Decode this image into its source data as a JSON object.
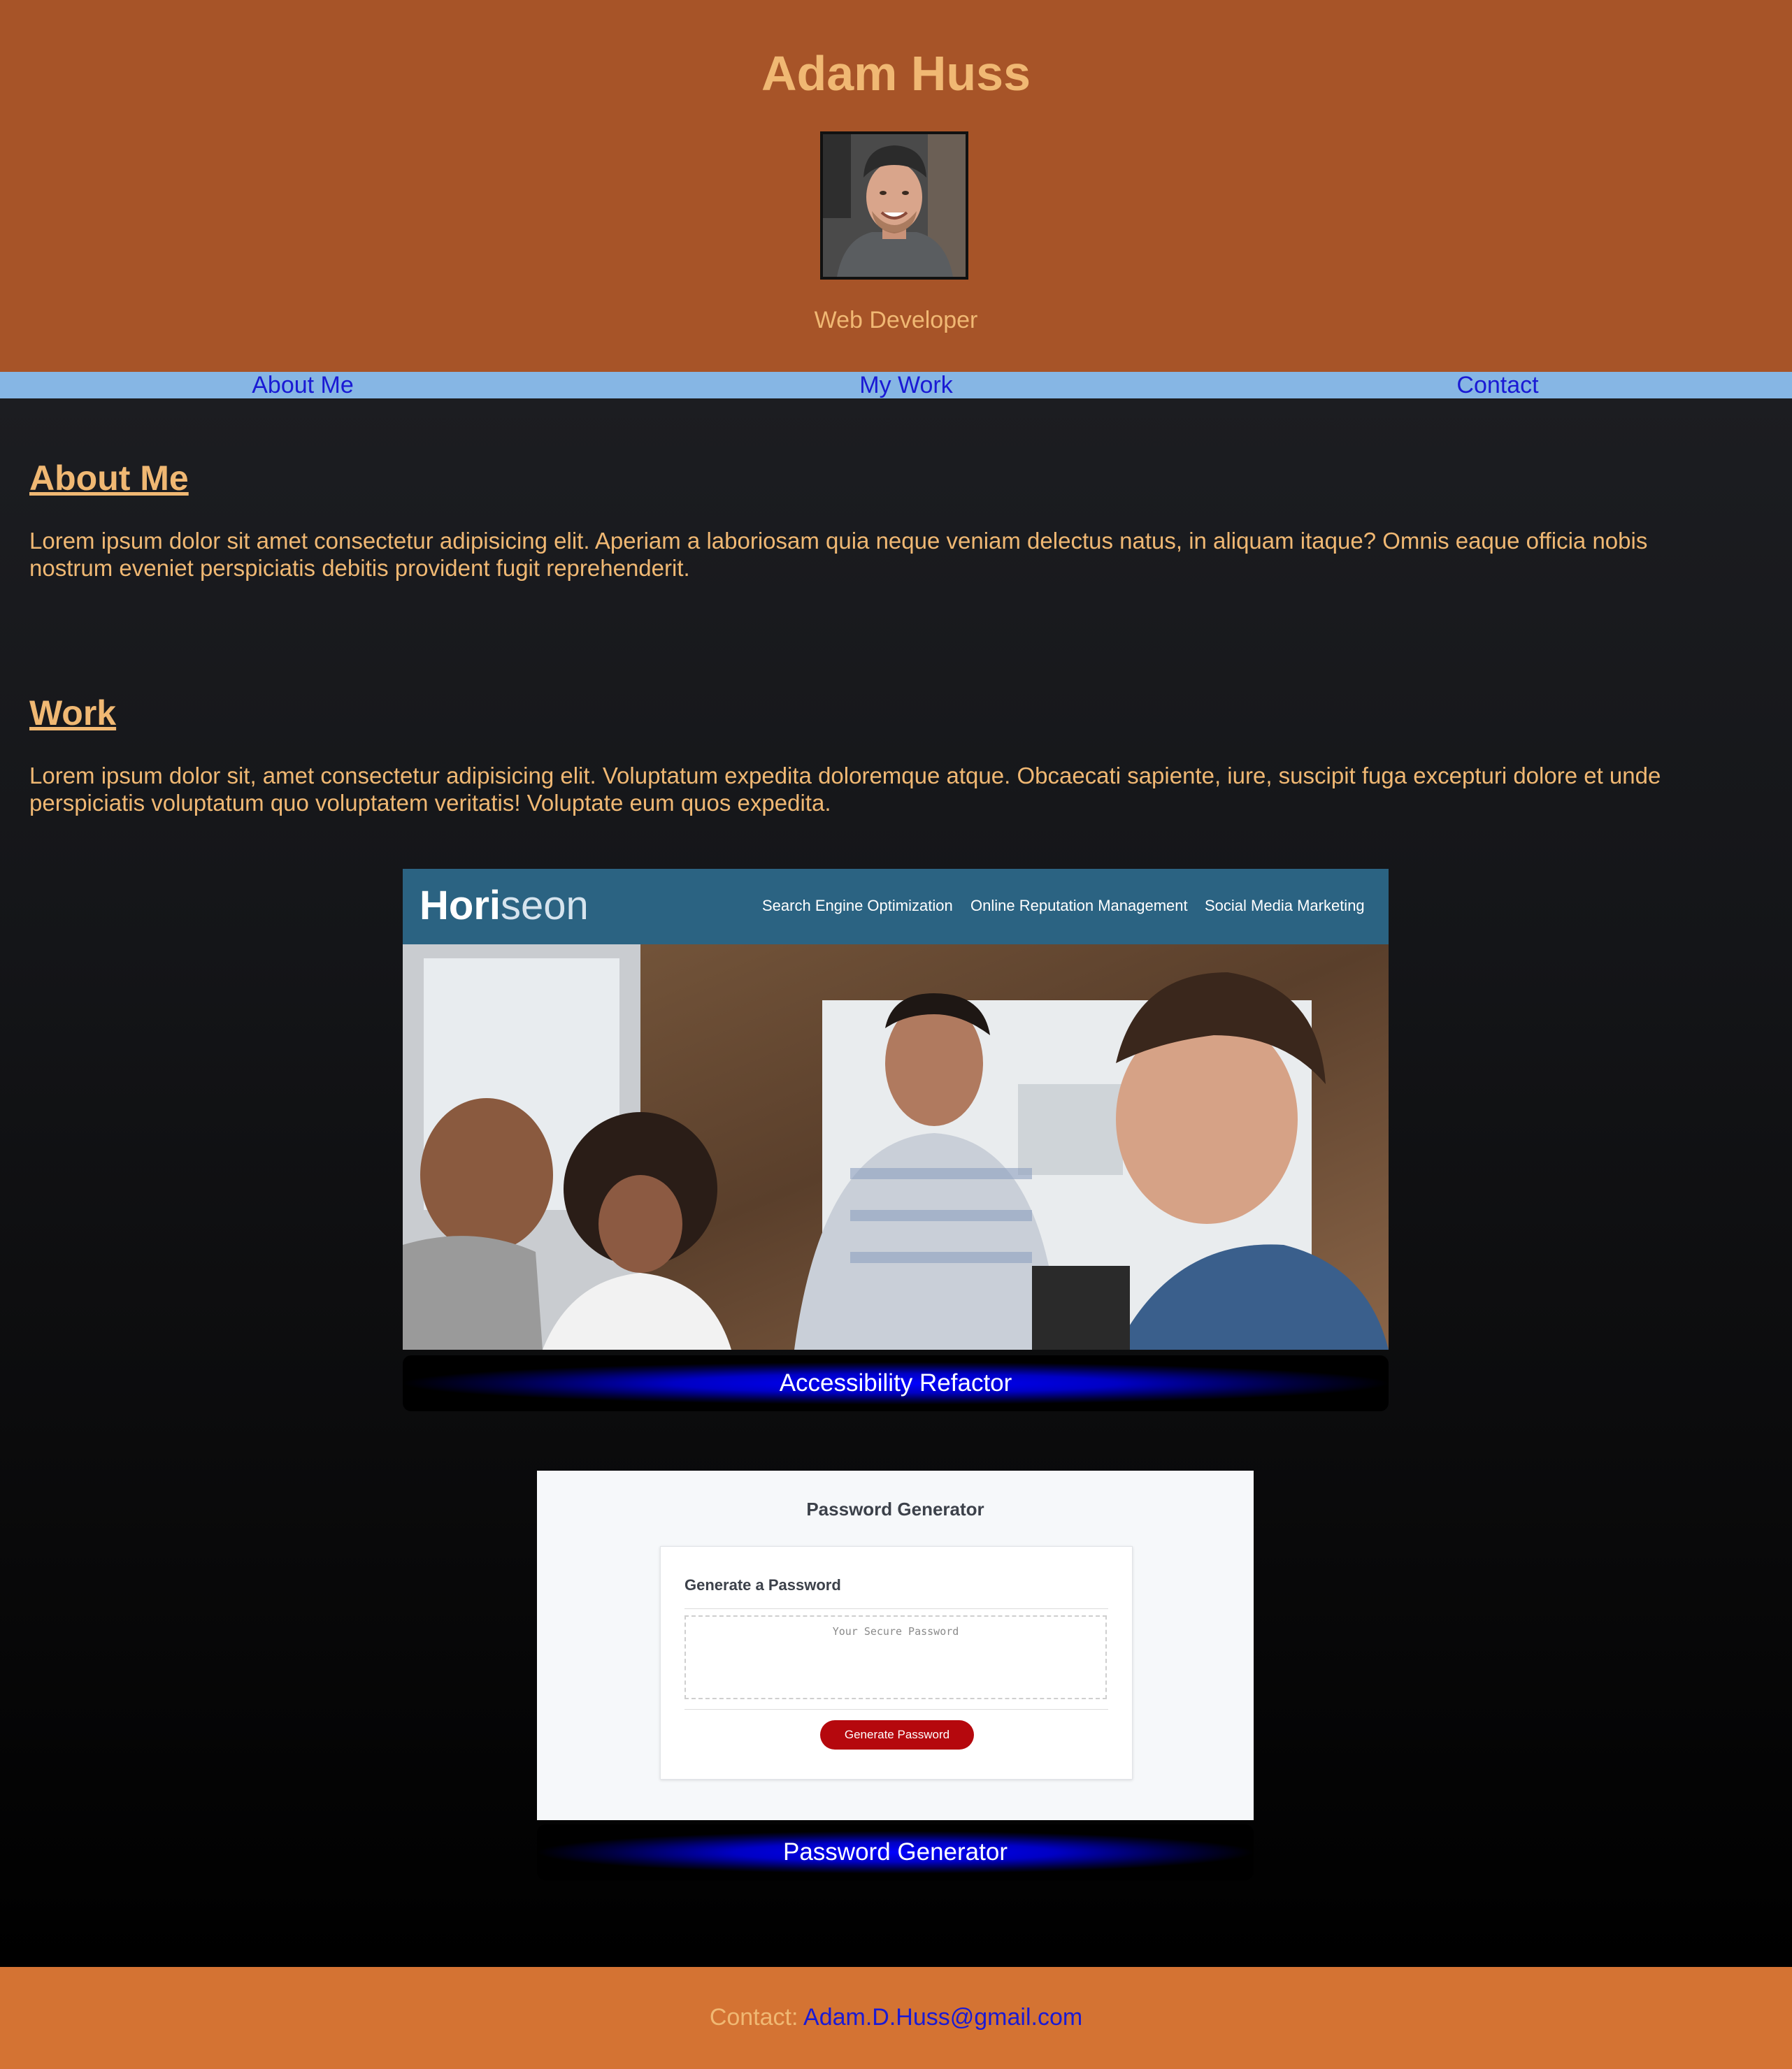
{
  "header": {
    "name": "Adam Huss",
    "role": "Web Developer"
  },
  "nav": {
    "items": [
      {
        "label": "About Me"
      },
      {
        "label": "My Work"
      },
      {
        "label": "Contact"
      }
    ]
  },
  "about": {
    "heading": "About Me",
    "text": "Lorem ipsum dolor sit amet consectetur adipisicing elit. Aperiam a laboriosam quia neque veniam delectus natus, in aliquam itaque? Omnis eaque officia nobis nostrum eveniet perspiciatis debitis provident fugit reprehenderit."
  },
  "work": {
    "heading": "Work",
    "text": "Lorem ipsum dolor sit, amet consectetur adipisicing elit. Voluptatum expedita doloremque atque. Obcaecati sapiente, iure, suscipit fuga excepturi dolore et unde perspiciatis voluptatum quo voluptatem veritatis! Voluptate eum quos expedita."
  },
  "projects": [
    {
      "caption": "Accessibility Refactor",
      "screenshot": {
        "logo_main": "Hori",
        "logo_accent": "seon",
        "nav": [
          "Search Engine Optimization",
          "Online Reputation Management",
          "Social Media Marketing"
        ]
      }
    },
    {
      "caption": "Password Generator",
      "screenshot": {
        "title": "Password Generator",
        "card_title": "Generate a Password",
        "placeholder": "Your Secure Password",
        "button": "Generate Password"
      }
    }
  ],
  "footer": {
    "label": "Contact:",
    "email": "Adam.D.Huss@gmail.com"
  },
  "colors": {
    "header_bg": "#a75428",
    "accent_text": "#f0b873",
    "nav_bg": "#86b6e4",
    "link": "#1a1ad4",
    "footer_bg": "#d47333"
  }
}
